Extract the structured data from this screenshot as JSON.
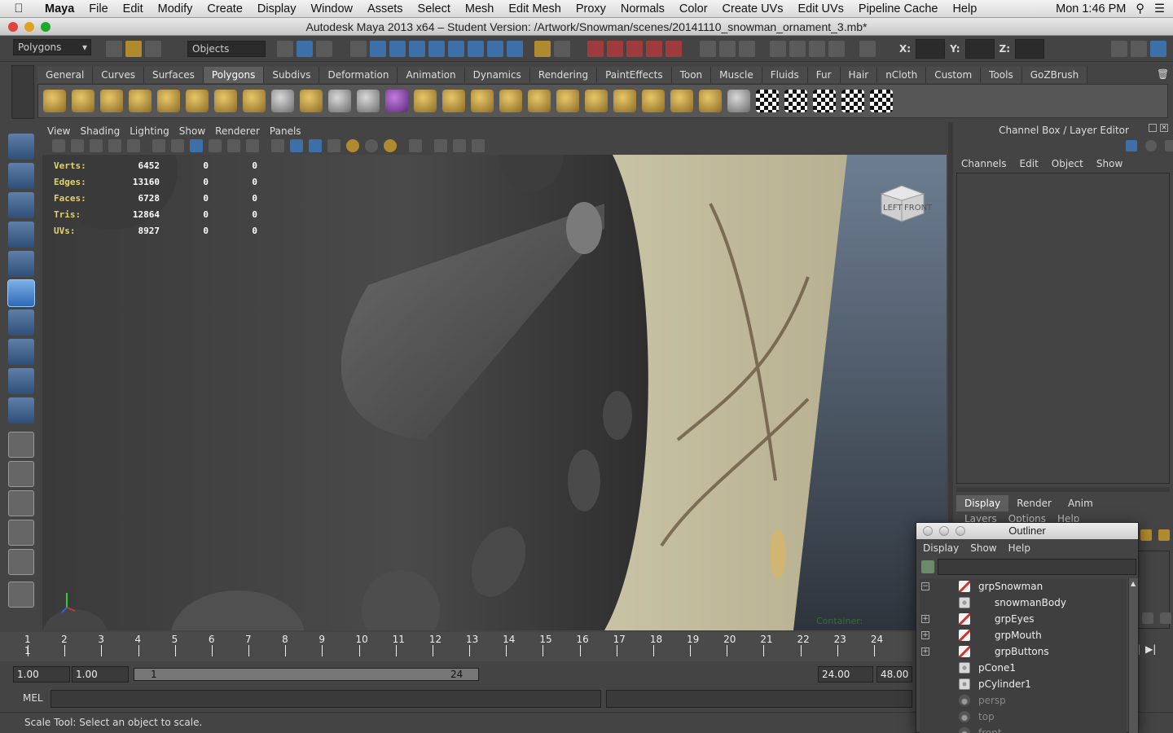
{
  "menubar": {
    "app": "Maya",
    "items": [
      "File",
      "Edit",
      "Modify",
      "Create",
      "Display",
      "Window",
      "Assets",
      "Select",
      "Mesh",
      "Edit Mesh",
      "Proxy",
      "Normals",
      "Color",
      "Create UVs",
      "Edit UVs",
      "Pipeline Cache",
      "Help"
    ],
    "clock": "Mon 1:46 PM"
  },
  "window": {
    "title": "Autodesk Maya 2013 x64 – Student Version: /Artwork/Snowman/scenes/20141110_snowman_ornament_3.mb*"
  },
  "statusline": {
    "menuset": "Polygons",
    "selection_mode": "Objects",
    "x_label": "X:",
    "y_label": "Y:",
    "z_label": "Z:"
  },
  "shelf": {
    "tabs": [
      "General",
      "Curves",
      "Surfaces",
      "Polygons",
      "Subdivs",
      "Deformation",
      "Animation",
      "Dynamics",
      "Rendering",
      "PaintEffects",
      "Toon",
      "Muscle",
      "Fluids",
      "Fur",
      "Hair",
      "nCloth",
      "Custom",
      "Tools",
      "GoZBrush"
    ],
    "active_tab": "Polygons"
  },
  "panel": {
    "menus": [
      "View",
      "Shading",
      "Lighting",
      "Show",
      "Renderer",
      "Panels"
    ],
    "hud": [
      {
        "label": "Verts:",
        "a": "6452",
        "b": "0",
        "c": "0"
      },
      {
        "label": "Edges:",
        "a": "13160",
        "b": "0",
        "c": "0"
      },
      {
        "label": "Faces:",
        "a": "6728",
        "b": "0",
        "c": "0"
      },
      {
        "label": "Tris:",
        "a": "12864",
        "b": "0",
        "c": "0"
      },
      {
        "label": "UVs:",
        "a": "8927",
        "b": "0",
        "c": "0"
      }
    ],
    "viewcube_left": "LEFT",
    "viewcube_front": "FRONT",
    "container_label": "Container:"
  },
  "channelbox": {
    "title": "Channel Box / Layer Editor",
    "menus": [
      "Channels",
      "Edit",
      "Object",
      "Show"
    ],
    "layer_tabs": [
      "Display",
      "Render",
      "Anim"
    ],
    "active_layer_tab": "Display",
    "layer_menus": [
      "Layers",
      "Options",
      "Help"
    ]
  },
  "timeslider": {
    "ticks": [
      "1",
      "2",
      "3",
      "4",
      "5",
      "6",
      "7",
      "8",
      "9",
      "10",
      "11",
      "12",
      "13",
      "14",
      "15",
      "16",
      "17",
      "18",
      "19",
      "20",
      "21",
      "22",
      "23",
      "24"
    ],
    "current_frame": "1"
  },
  "rangeslider": {
    "start_time": "1.00",
    "playback_start": "1.00",
    "range_start": "1",
    "range_end": "24",
    "playback_end": "24.00",
    "end_time": "48.00"
  },
  "commandline": {
    "label": "MEL"
  },
  "helpline": {
    "text": "Scale Tool: Select an object to scale."
  },
  "outliner": {
    "title": "Outliner",
    "menus": [
      "Display",
      "Show",
      "Help"
    ],
    "items": [
      {
        "name": "grpSnowman",
        "type": "group",
        "expand": "minus",
        "indent": 0,
        "dim": false
      },
      {
        "name": "snowmanBody",
        "type": "mesh",
        "expand": "",
        "indent": 1,
        "dim": false
      },
      {
        "name": "grpEyes",
        "type": "group",
        "expand": "plus",
        "indent": 1,
        "dim": false
      },
      {
        "name": "grpMouth",
        "type": "group",
        "expand": "plus",
        "indent": 1,
        "dim": false
      },
      {
        "name": "grpButtons",
        "type": "group",
        "expand": "plus",
        "indent": 1,
        "dim": false
      },
      {
        "name": "pCone1",
        "type": "mesh",
        "expand": "",
        "indent": 0,
        "dim": false
      },
      {
        "name": "pCylinder1",
        "type": "mesh",
        "expand": "",
        "indent": 0,
        "dim": false
      },
      {
        "name": "persp",
        "type": "camera",
        "expand": "",
        "indent": 0,
        "dim": true
      },
      {
        "name": "top",
        "type": "camera",
        "expand": "",
        "indent": 0,
        "dim": true
      },
      {
        "name": "front",
        "type": "camera",
        "expand": "",
        "indent": 0,
        "dim": true
      }
    ]
  },
  "colors": {
    "accent": "#5e5e5e",
    "hud_label": "#e2d36a",
    "viewport_top": "#6d7e92",
    "viewport_bottom": "#2e343c"
  }
}
